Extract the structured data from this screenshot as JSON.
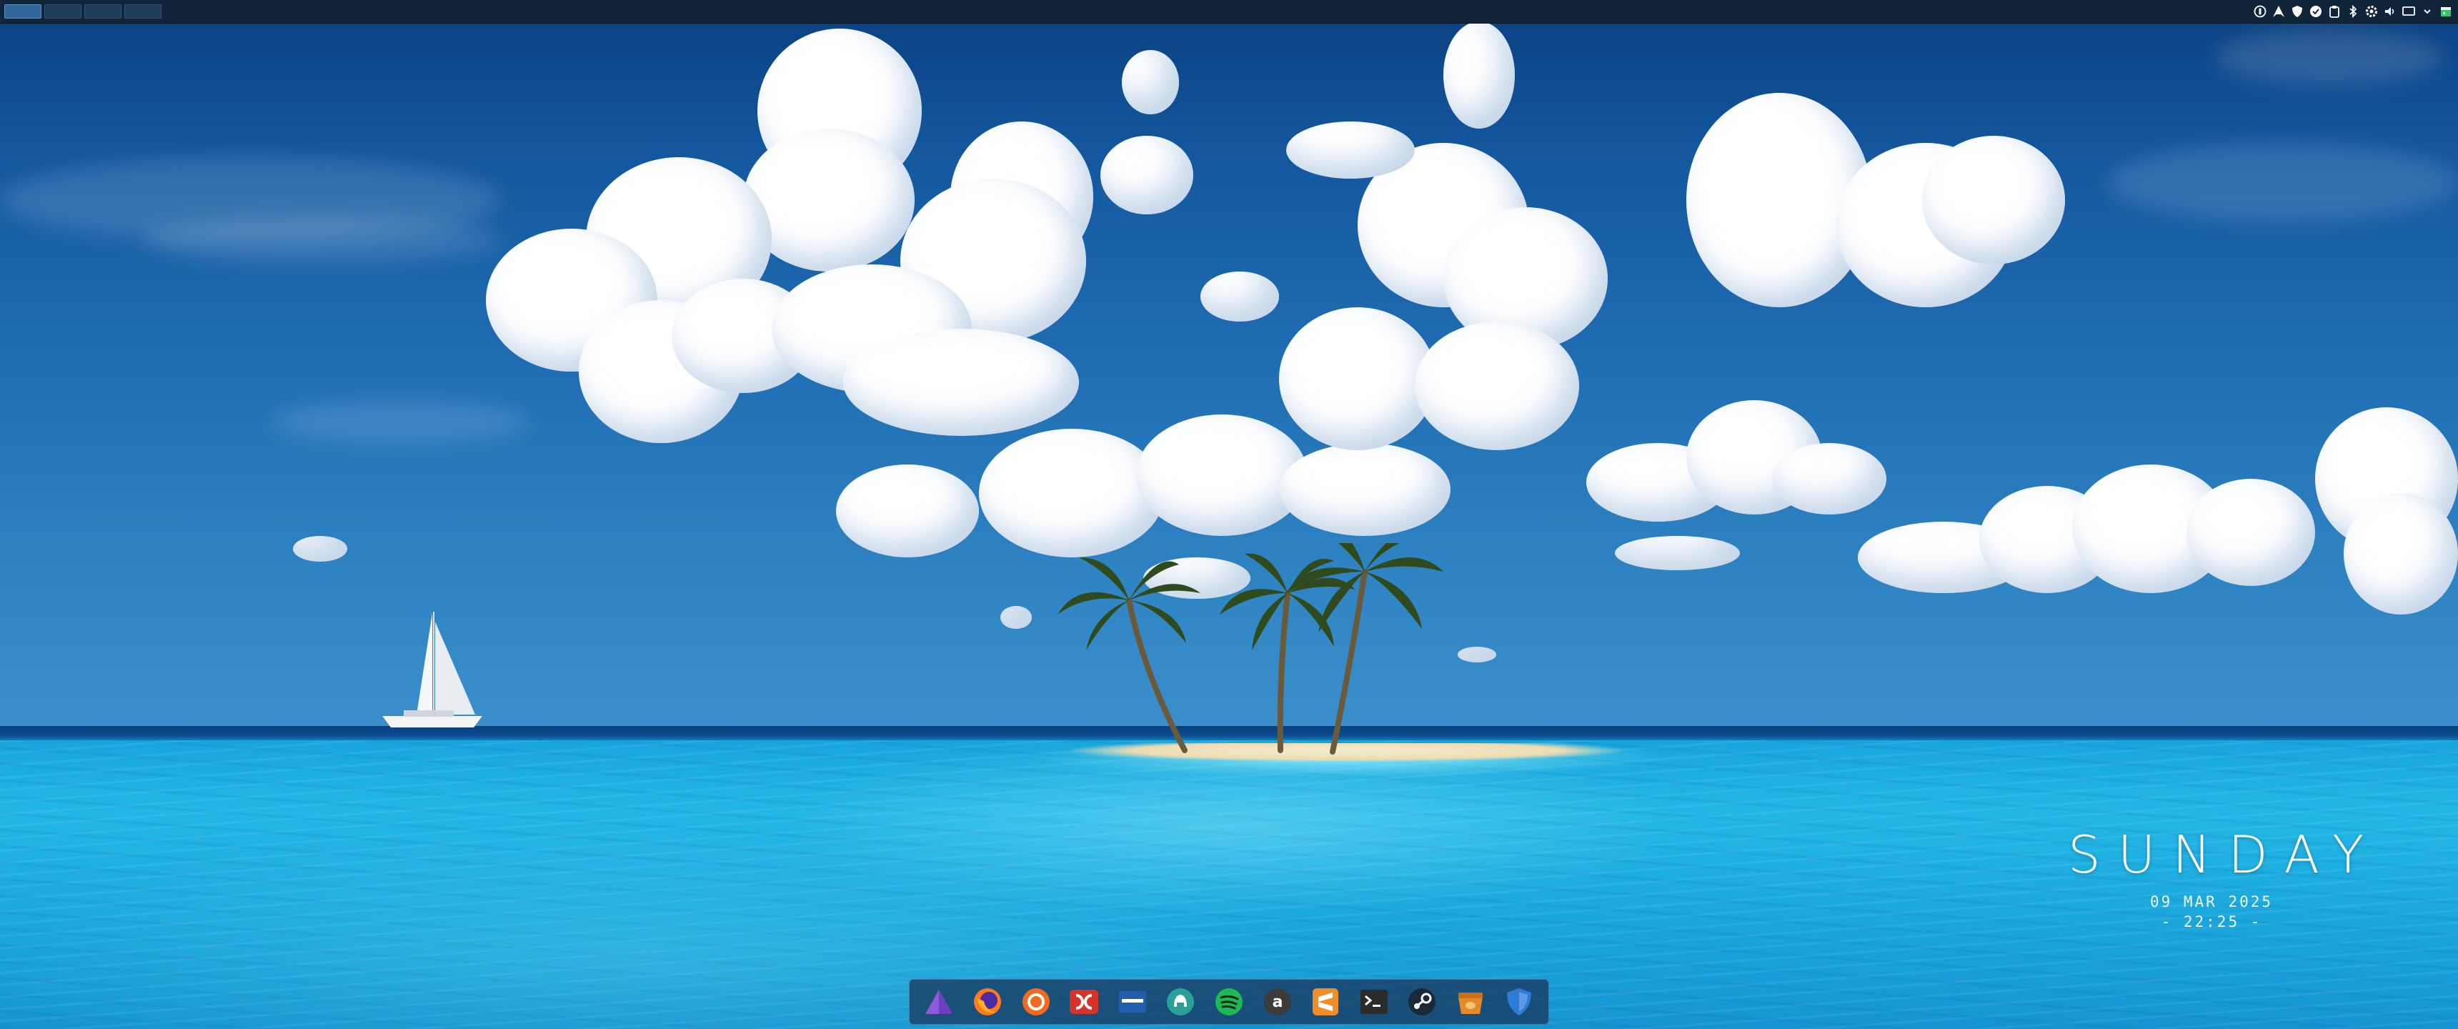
{
  "workspaces": [
    {
      "index": 1,
      "active": true
    },
    {
      "index": 2,
      "active": false
    },
    {
      "index": 3,
      "active": false
    },
    {
      "index": 4,
      "active": false
    }
  ],
  "tray": [
    {
      "name": "user-status-icon"
    },
    {
      "name": "arch-icon"
    },
    {
      "name": "shield-icon"
    },
    {
      "name": "checkmark-icon"
    },
    {
      "name": "clipboard-icon"
    },
    {
      "name": "bluetooth-icon"
    },
    {
      "name": "settings-icon"
    },
    {
      "name": "volume-icon"
    },
    {
      "name": "display-icon"
    },
    {
      "name": "chevron-down-icon"
    },
    {
      "name": "calendar-icon"
    }
  ],
  "clock": {
    "day": "SUNDAY",
    "date": "09 MAR 2025",
    "time": "- 22:25 -"
  },
  "dock": [
    {
      "name": "launcher-icon",
      "color": "#8c5bd8"
    },
    {
      "name": "firefox-icon",
      "color": "#ff7a1a"
    },
    {
      "name": "browser-orange-icon",
      "color": "#f26a1b"
    },
    {
      "name": "dc-icon",
      "color": "#d6342b"
    },
    {
      "name": "files-icon",
      "color": "#1f5fae"
    },
    {
      "name": "github-desktop-icon",
      "color": "#2aa198"
    },
    {
      "name": "spotify-icon",
      "color": "#1db954"
    },
    {
      "name": "amazon-icon",
      "color": "#3b3b3b"
    },
    {
      "name": "sublime-text-icon",
      "color": "#ef8d2b"
    },
    {
      "name": "terminal-icon",
      "color": "#2b2b2b"
    },
    {
      "name": "steam-icon",
      "color": "#1b2838"
    },
    {
      "name": "package-icon",
      "color": "#e6892a"
    },
    {
      "name": "bitwarden-icon",
      "color": "#2f7bd8"
    }
  ]
}
